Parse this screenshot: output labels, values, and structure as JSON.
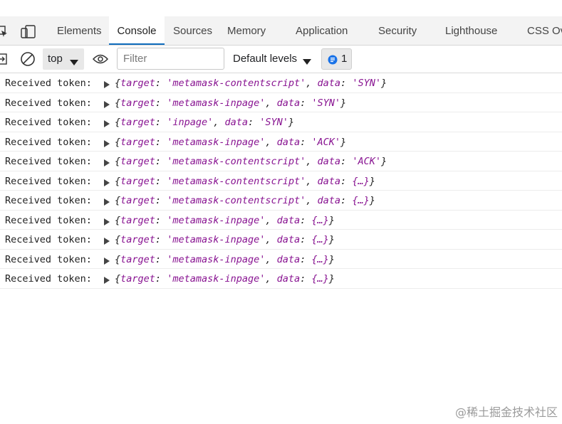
{
  "tabs": [
    {
      "label": "Elements",
      "active": false
    },
    {
      "label": "Console",
      "active": true
    },
    {
      "label": "Sources",
      "active": false
    },
    {
      "label": "Memory",
      "active": false
    },
    {
      "label": "Application",
      "active": false
    },
    {
      "label": "Security",
      "active": false
    },
    {
      "label": "Lighthouse",
      "active": false
    },
    {
      "label": "CSS Ov",
      "active": false
    }
  ],
  "icons": {
    "inspect": "inspect-element-icon",
    "device": "device-emulation-icon",
    "sidebar": "show-sidebar-icon",
    "clear": "clear-console-icon",
    "eye": "live-expression-icon",
    "issues": "issues-icon"
  },
  "toolbar": {
    "context": "top",
    "filter_placeholder": "Filter",
    "levels": "Default levels",
    "issues_count": "1"
  },
  "colors": {
    "accent": "#0f6cbd",
    "key": "#881391",
    "badge": "#1a73e8"
  },
  "log": [
    {
      "message": "Received token:",
      "target": "'metamask-contentscript'",
      "data": "'SYN'"
    },
    {
      "message": "Received token:",
      "target": "'metamask-inpage'",
      "data": "'SYN'"
    },
    {
      "message": "Received token:",
      "target": "'inpage'",
      "data": "'SYN'"
    },
    {
      "message": "Received token:",
      "target": "'metamask-inpage'",
      "data": "'ACK'"
    },
    {
      "message": "Received token:",
      "target": "'metamask-contentscript'",
      "data": "'ACK'"
    },
    {
      "message": "Received token:",
      "target": "'metamask-contentscript'",
      "data": "{…}"
    },
    {
      "message": "Received token:",
      "target": "'metamask-contentscript'",
      "data": "{…}"
    },
    {
      "message": "Received token:",
      "target": "'metamask-inpage'",
      "data": "{…}"
    },
    {
      "message": "Received token:",
      "target": "'metamask-inpage'",
      "data": "{…}"
    },
    {
      "message": "Received token:",
      "target": "'metamask-inpage'",
      "data": "{…}"
    },
    {
      "message": "Received token:",
      "target": "'metamask-inpage'",
      "data": "{…}"
    }
  ],
  "watermark": "@稀土掘金技术社区"
}
